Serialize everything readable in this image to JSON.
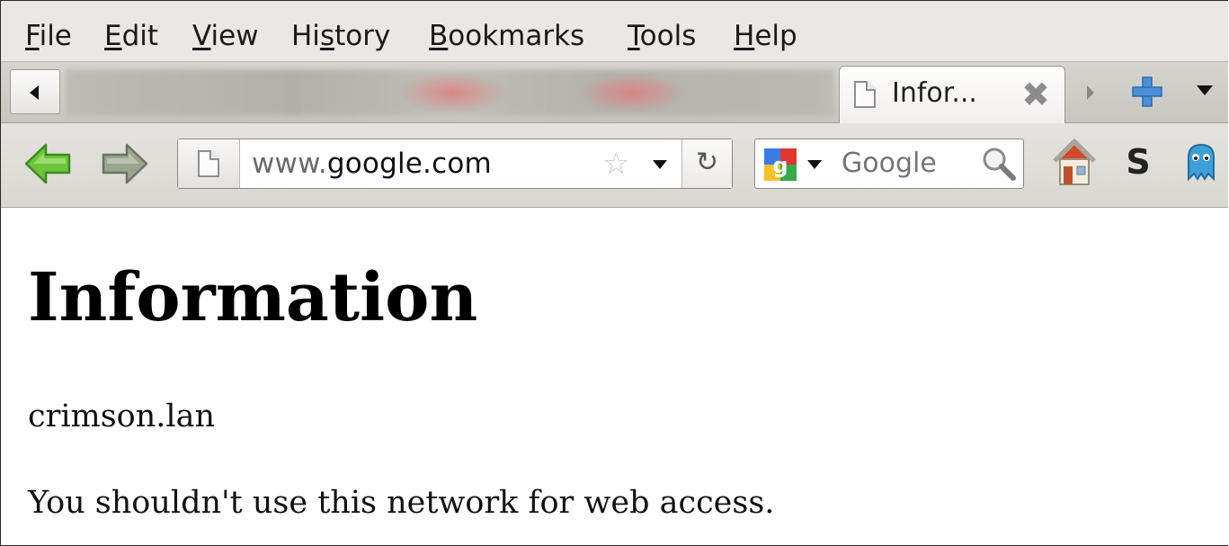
{
  "menubar": {
    "items": [
      {
        "pre": "",
        "key": "F",
        "post": "ile"
      },
      {
        "pre": "",
        "key": "E",
        "post": "dit"
      },
      {
        "pre": "",
        "key": "V",
        "post": "iew"
      },
      {
        "pre": "Hi",
        "key": "s",
        "post": "tory"
      },
      {
        "pre": "",
        "key": "B",
        "post": "ookmarks"
      },
      {
        "pre": "",
        "key": "T",
        "post": "ools"
      },
      {
        "pre": "",
        "key": "H",
        "post": "elp"
      }
    ]
  },
  "tabs": {
    "active_title": "Infor...",
    "close_glyph": "✖"
  },
  "navbar": {
    "url_prefix": "www.",
    "url_host": "google.com",
    "star_glyph": "☆",
    "reload_glyph": "↻",
    "search_placeholder": "Google",
    "s_button": "S"
  },
  "page": {
    "heading": "Information",
    "host": "crimson.lan",
    "message": "You shouldn't use this network for web access."
  },
  "colors": {
    "back_arrow": "#6cc63a",
    "forward_arrow": "#9aa58e",
    "new_tab_plus": "#4a8fd8",
    "home_roof": "#d24a2a",
    "ghost": "#3d9fd6"
  }
}
